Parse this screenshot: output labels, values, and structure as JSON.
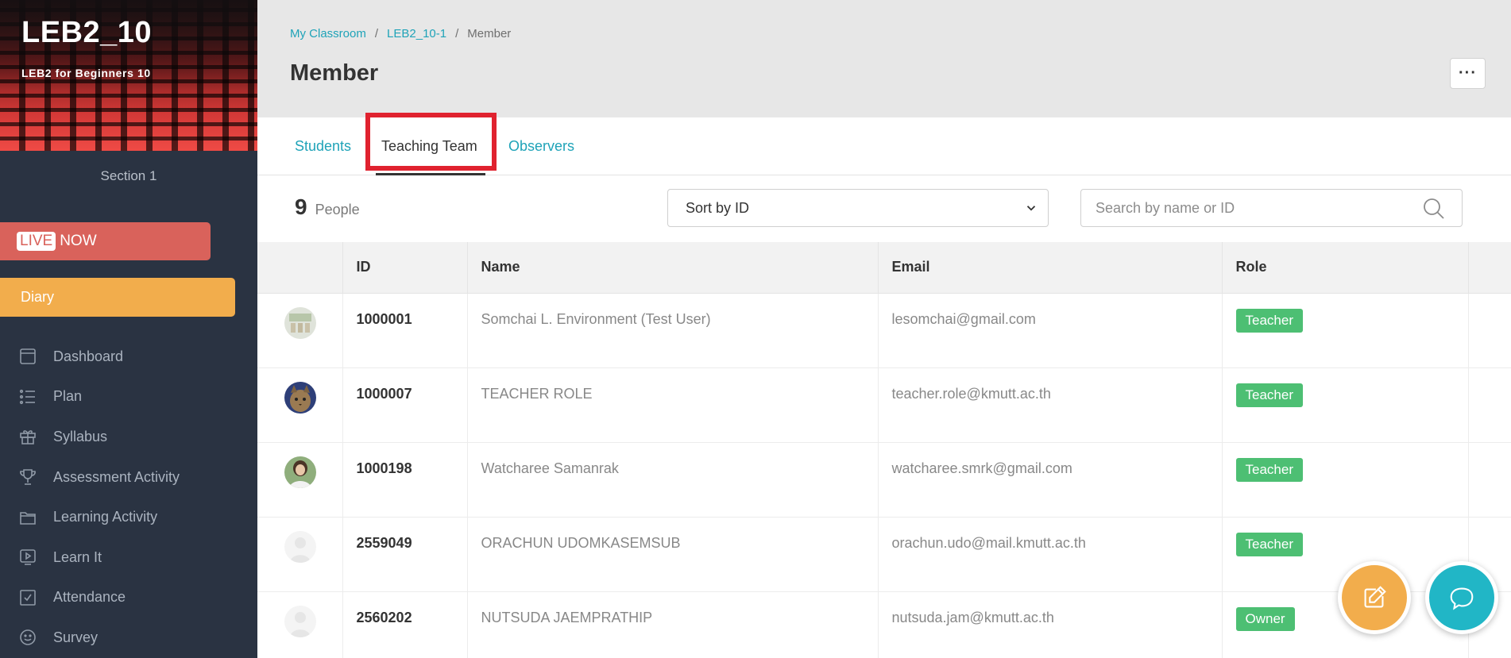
{
  "course": {
    "code": "LEB2_10",
    "name": "LEB2 for Beginners 10",
    "section": "Section 1"
  },
  "sidebar": {
    "live_tag": "LIVE",
    "live_text": "NOW",
    "diary_label": "Diary",
    "items": [
      {
        "label": "Dashboard",
        "icon": "dashboard-icon"
      },
      {
        "label": "Plan",
        "icon": "list-icon"
      },
      {
        "label": "Syllabus",
        "icon": "gift-icon"
      },
      {
        "label": "Assessment Activity",
        "icon": "trophy-icon"
      },
      {
        "label": "Learning Activity",
        "icon": "folder-icon"
      },
      {
        "label": "Learn It",
        "icon": "play-icon"
      },
      {
        "label": "Attendance",
        "icon": "checkbox-icon"
      },
      {
        "label": "Survey",
        "icon": "smiley-icon"
      }
    ]
  },
  "header": {
    "breadcrumb": [
      "My Classroom",
      "LEB2_10-1",
      "Member"
    ],
    "title": "Member",
    "more_label": "···"
  },
  "tabs": [
    {
      "label": "Students",
      "active": false
    },
    {
      "label": "Teaching Team",
      "active": true
    },
    {
      "label": "Observers",
      "active": false
    }
  ],
  "controls": {
    "count": "9",
    "count_label": "People",
    "sort_selected": "Sort by ID",
    "search_placeholder": "Search by name or ID"
  },
  "table": {
    "columns": [
      "ID",
      "Name",
      "Email",
      "Role"
    ],
    "rows": [
      {
        "id": "1000001",
        "name": "Somchai L. Environment (Test User)",
        "email": "lesomchai@gmail.com",
        "role": "Teacher",
        "avatar": "photo-classroom"
      },
      {
        "id": "1000007",
        "name": "TEACHER ROLE",
        "email": "teacher.role@kmutt.ac.th",
        "role": "Teacher",
        "avatar": "photo-cat"
      },
      {
        "id": "1000198",
        "name": "Watcharee Samanrak",
        "email": "watcharee.smrk@gmail.com",
        "role": "Teacher",
        "avatar": "photo-person"
      },
      {
        "id": "2559049",
        "name": "ORACHUN UDOMKASEMSUB",
        "email": "orachun.udo@mail.kmutt.ac.th",
        "role": "Teacher",
        "avatar": "placeholder"
      },
      {
        "id": "2560202",
        "name": "NUTSUDA JAEMPRATHIP",
        "email": "nutsuda.jam@kmutt.ac.th",
        "role": "Owner",
        "avatar": "placeholder"
      }
    ]
  },
  "colors": {
    "teacher_badge": "#4dbf73",
    "accent": "#1fa3b8",
    "diary": "#f2ad4c",
    "live": "#d9625b"
  }
}
